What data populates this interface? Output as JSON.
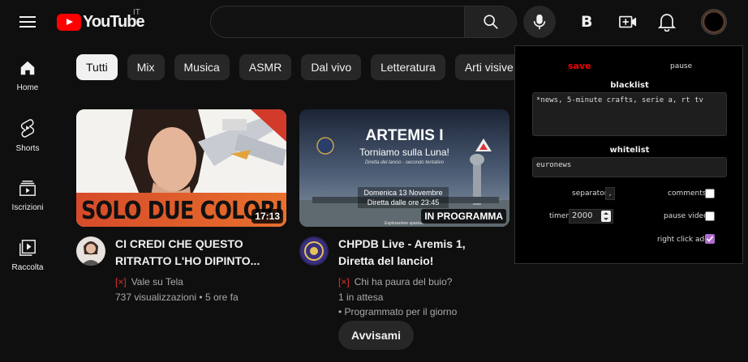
{
  "header": {
    "logo_text": "YouTube",
    "country_code": "IT",
    "search_value": "",
    "b_label": "B"
  },
  "sidebar": {
    "items": [
      {
        "label": "Home",
        "icon": "home-icon"
      },
      {
        "label": "Shorts",
        "icon": "shorts-icon"
      },
      {
        "label": "Iscrizioni",
        "icon": "subscriptions-icon"
      },
      {
        "label": "Raccolta",
        "icon": "library-icon"
      }
    ]
  },
  "chips": [
    "Tutti",
    "Mix",
    "Musica",
    "ASMR",
    "Dal vivo",
    "Letteratura",
    "Arti visive"
  ],
  "videos": [
    {
      "thumb_text": "SOLO DUE COLORI",
      "duration": "17:13",
      "title": "CI CREDI CHE QUESTO RITRATTO L'HO DIPINTO...",
      "flag": "[×]",
      "channel": "Vale su Tela",
      "views": "737 visualizzazioni",
      "age": "5 ore fa"
    },
    {
      "thumb_title": "ARTEMIS I",
      "thumb_subtitle": "Torniamo sulla Luna!",
      "thumb_small": "Diretta del lancio - secondo tentativo",
      "thumb_date": "Domenica 13 Novembre",
      "thumb_time": "Diretta dalle ore 23:45",
      "thumb_footer": "Esplorazione spaziale",
      "badge": "IN PROGRAMMA",
      "title": "CHPDB Live - Aremis 1, Diretta del lancio!",
      "flag": "[×]",
      "channel": "Chi ha paura del buio?",
      "waiting": "1 in attesa",
      "scheduled": "• Programmato per il giorno",
      "notify_label": "Avvisami"
    }
  ],
  "panel": {
    "save_label": "save",
    "pause_label": "pause",
    "blacklist_label": "blacklist",
    "blacklist_value": "*news, 5-minute crafts, serie a, rt tv",
    "whitelist_label": "whitelist",
    "whitelist_value": "euronews",
    "separator_label": "separator",
    "separator_value": ",",
    "comments_label": "comments",
    "timer_label": "timer",
    "timer_value": "2000",
    "pause_video_label": "pause video",
    "right_click_label": "right click add",
    "comments_checked": false,
    "pause_video_checked": false,
    "right_click_checked": true
  },
  "colors": {
    "accent_red": "#ff0000",
    "panel_save": "#ee0000",
    "checkbox_checked": "#b06ad0"
  }
}
